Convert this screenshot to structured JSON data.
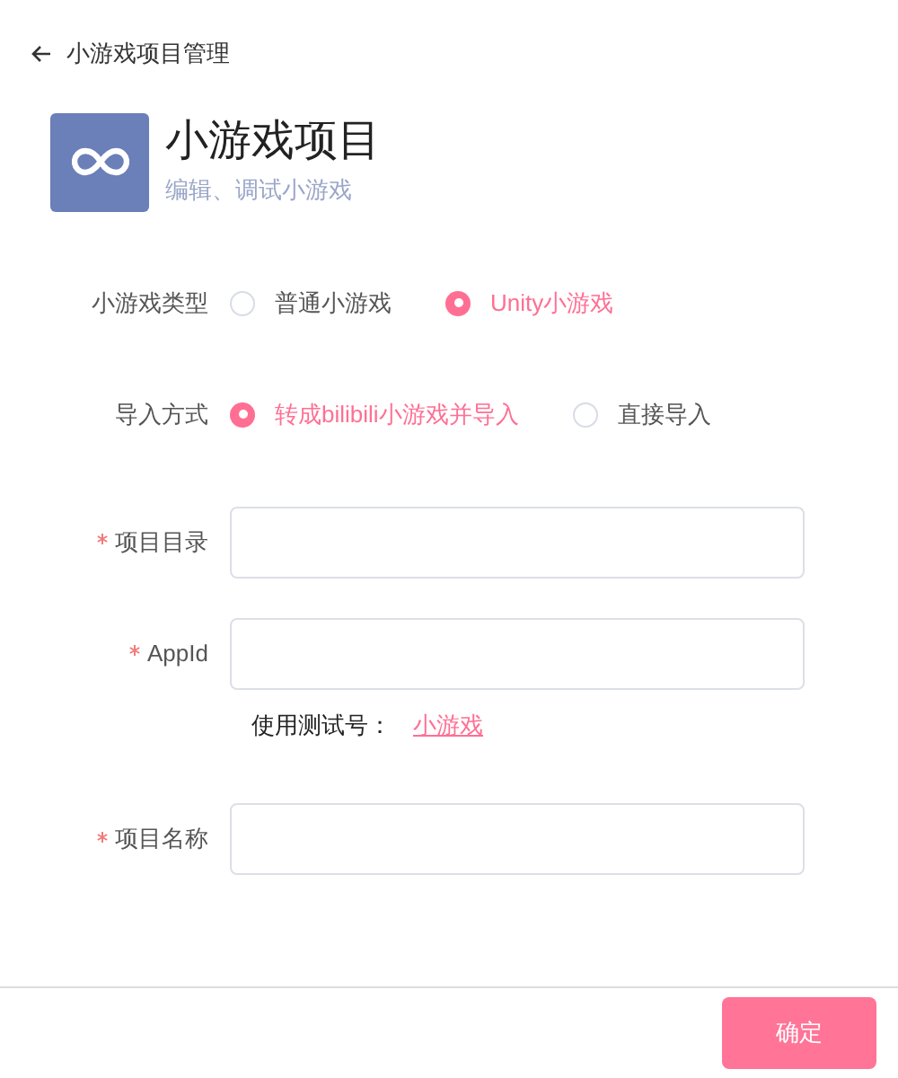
{
  "back_link": {
    "label": "小游戏项目管理"
  },
  "header": {
    "title": "小游戏项目",
    "subtitle": "编辑、调试小游戏"
  },
  "radio_groups": [
    {
      "label": "小游戏类型",
      "options": [
        {
          "label": "普通小游戏",
          "selected": false
        },
        {
          "label": "Unity小游戏",
          "selected": true
        }
      ]
    },
    {
      "label": "导入方式",
      "options": [
        {
          "label": "转成bilibili小游戏并导入",
          "selected": true
        },
        {
          "label": "直接导入",
          "selected": false
        }
      ]
    }
  ],
  "fields": [
    {
      "label": "项目目录",
      "required": true
    },
    {
      "label": "AppId",
      "required": true,
      "hint": {
        "label": "使用测试号：",
        "link": "小游戏"
      }
    },
    {
      "label": "项目名称",
      "required": true
    }
  ],
  "confirm_button": "确定"
}
